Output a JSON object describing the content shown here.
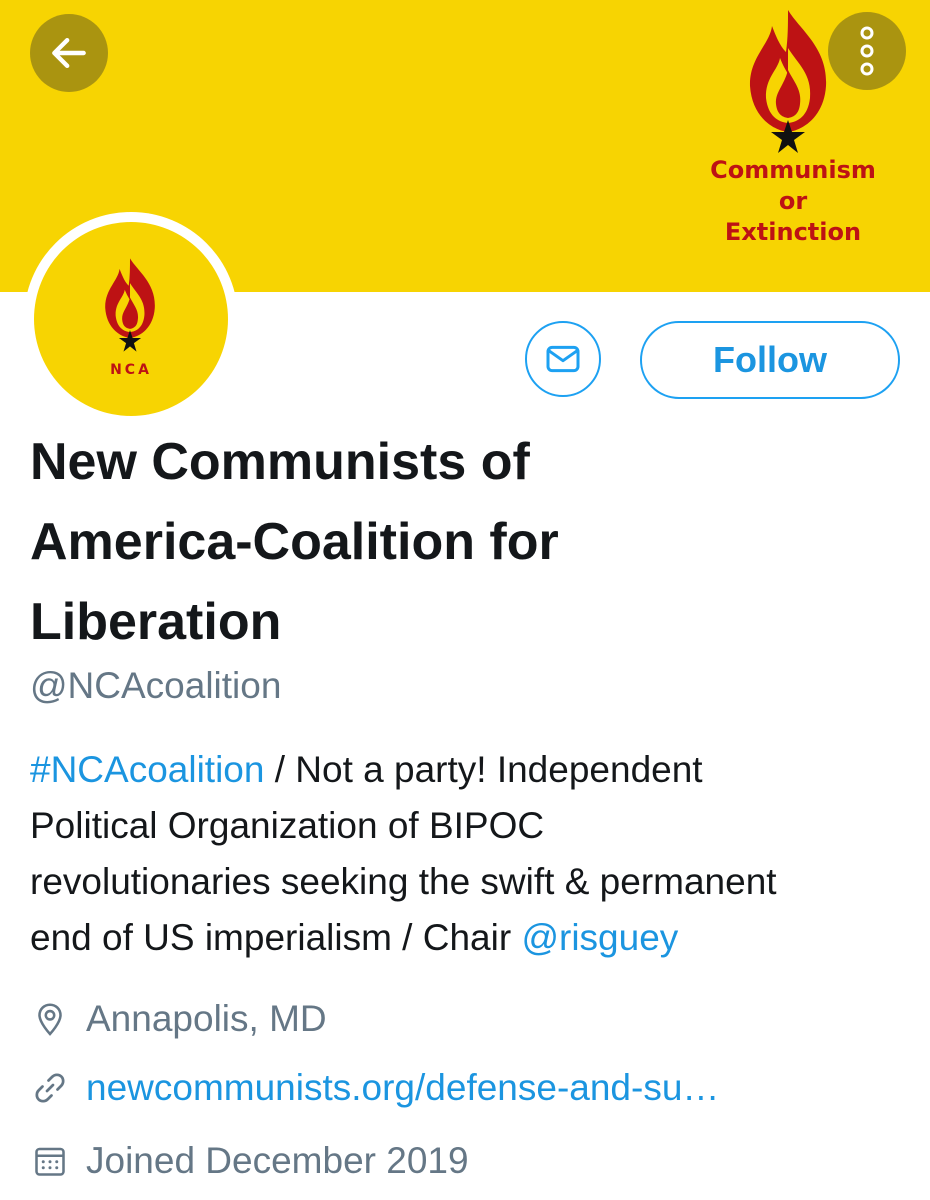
{
  "banner": {
    "slogan_line1": "Communism",
    "slogan_line2": "or",
    "slogan_line3": "Extinction",
    "background_color": "#f7d402",
    "flame_color": "#bd1214"
  },
  "avatar": {
    "text": "NCA"
  },
  "actions": {
    "back_icon": "arrow-left-icon",
    "more_icon": "more-vertical-icon",
    "message_icon": "envelope-icon",
    "follow_label": "Follow"
  },
  "profile": {
    "name_line1": "New Communists of",
    "name_line2": "America-Coalition for",
    "name_line3": "Liberation",
    "handle": "@NCAcoalition",
    "bio": {
      "hashtag": "#NCAcoalition",
      "line1_rest": " / Not a party! Independent",
      "line2": "Political Organization of BIPOC",
      "line3": "revolutionaries seeking the swift & permanent",
      "line4_start": "end of US imperialism / Chair ",
      "mention": "@risguey"
    },
    "location": "Annapolis, MD",
    "website": "newcommunists.org/defense-and-su…",
    "joined": "Joined December 2019"
  },
  "colors": {
    "accent": "#1da1f2",
    "link": "#1b95e0",
    "secondary_text": "#657786"
  }
}
